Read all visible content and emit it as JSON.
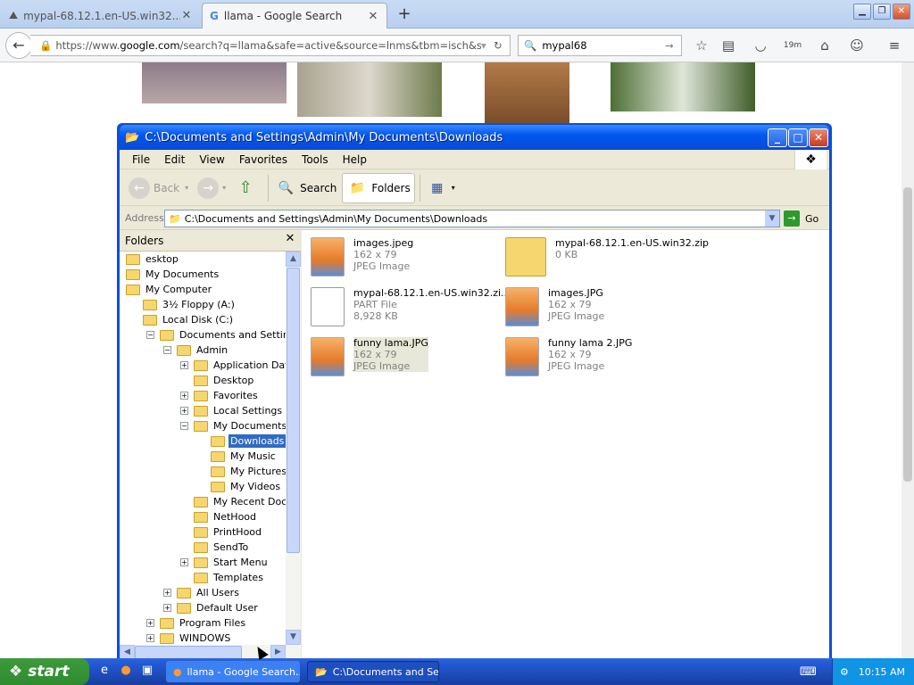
{
  "browser": {
    "tabs": [
      {
        "title": "mypal-68.12.1.en-US.win32....",
        "active": false
      },
      {
        "title": "llama - Google Search",
        "active": true
      }
    ],
    "url_prefix": "https://www.",
    "url_domain": "google.com",
    "url_rest": "/search?q=llama&safe=active&source=lnms&tbm=isch&sa=X&ved=0ahU",
    "search_value": "mypal68",
    "badge": "19m"
  },
  "explorer": {
    "title": "C:\\Documents and Settings\\Admin\\My Documents\\Downloads",
    "menus": [
      "File",
      "Edit",
      "View",
      "Favorites",
      "Tools",
      "Help"
    ],
    "toolbar": {
      "back": "Back",
      "search": "Search",
      "folders": "Folders"
    },
    "address_label": "Address",
    "address_value": "C:\\Documents and Settings\\Admin\\My Documents\\Downloads",
    "go_label": "Go",
    "folders_header": "Folders",
    "tree": [
      {
        "label": "esktop",
        "level": 0,
        "exp": ""
      },
      {
        "label": "My Documents",
        "level": 0,
        "exp": ""
      },
      {
        "label": "My Computer",
        "level": 0,
        "exp": ""
      },
      {
        "label": "3½ Floppy (A:)",
        "level": 1,
        "exp": ""
      },
      {
        "label": "Local Disk (C:)",
        "level": 1,
        "exp": ""
      },
      {
        "label": "Documents and Settings",
        "level": 2,
        "exp": "−"
      },
      {
        "label": "Admin",
        "level": 3,
        "exp": "−"
      },
      {
        "label": "Application Data",
        "level": 4,
        "exp": "+"
      },
      {
        "label": "Desktop",
        "level": 4,
        "exp": ""
      },
      {
        "label": "Favorites",
        "level": 4,
        "exp": "+"
      },
      {
        "label": "Local Settings",
        "level": 4,
        "exp": "+"
      },
      {
        "label": "My Documents",
        "level": 4,
        "exp": "−"
      },
      {
        "label": "Downloads",
        "level": 5,
        "exp": "",
        "selected": true
      },
      {
        "label": "My Music",
        "level": 5,
        "exp": ""
      },
      {
        "label": "My Pictures",
        "level": 5,
        "exp": ""
      },
      {
        "label": "My Videos",
        "level": 5,
        "exp": ""
      },
      {
        "label": "My Recent Documents",
        "level": 4,
        "exp": ""
      },
      {
        "label": "NetHood",
        "level": 4,
        "exp": ""
      },
      {
        "label": "PrintHood",
        "level": 4,
        "exp": ""
      },
      {
        "label": "SendTo",
        "level": 4,
        "exp": ""
      },
      {
        "label": "Start Menu",
        "level": 4,
        "exp": "+"
      },
      {
        "label": "Templates",
        "level": 4,
        "exp": ""
      },
      {
        "label": "All Users",
        "level": 3,
        "exp": "+"
      },
      {
        "label": "Default User",
        "level": 3,
        "exp": "+"
      },
      {
        "label": "Program Files",
        "level": 2,
        "exp": "+"
      },
      {
        "label": "WINDOWS",
        "level": 2,
        "exp": "+"
      }
    ],
    "files": [
      {
        "name": "images.jpeg",
        "line2": "162 x 79",
        "line3": "JPEG Image",
        "kind": "img"
      },
      {
        "name": "mypal-68.12.1.en-US.win32.zip",
        "line2": "0 KB",
        "line3": "",
        "kind": "zip"
      },
      {
        "name": "mypal-68.12.1.en-US.win32.zi...",
        "line2": "PART File",
        "line3": "8,928 KB",
        "kind": "doc"
      },
      {
        "name": "images.JPG",
        "line2": "162 x 79",
        "line3": "JPEG Image",
        "kind": "img"
      },
      {
        "name": "funny lama.JPG",
        "line2": "162 x 79",
        "line3": "JPEG Image",
        "kind": "img",
        "highlight": true
      },
      {
        "name": "funny lama 2.JPG",
        "line2": "162 x 79",
        "line3": "JPEG Image",
        "kind": "img"
      }
    ]
  },
  "taskbar": {
    "start": "start",
    "items": [
      "llama - Google Search...",
      "C:\\Documents and Se..."
    ],
    "clock": "10:15 AM"
  }
}
